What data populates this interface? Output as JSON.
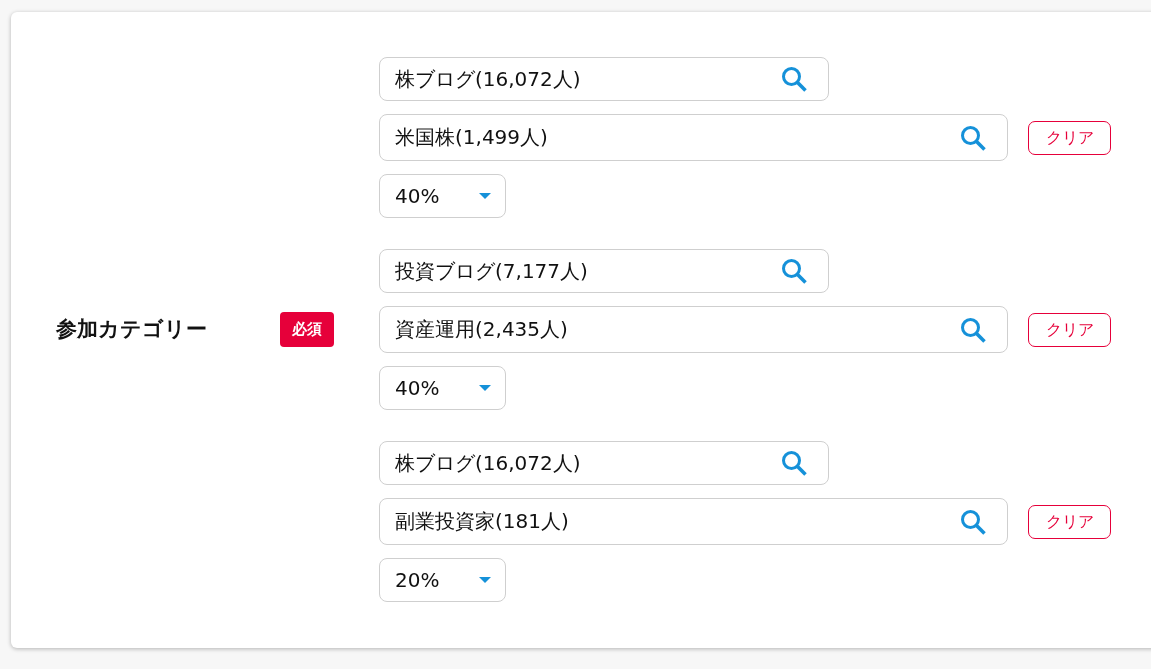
{
  "form": {
    "label": "参加カテゴリー",
    "required_badge": "必須",
    "categories": [
      {
        "parent": {
          "value": "株ブログ(16,072人)"
        },
        "child": {
          "value": "米国株(1,499人)"
        },
        "clear_button": "クリア",
        "ratio": "40%"
      },
      {
        "parent": {
          "value": "投資ブログ(7,177人)"
        },
        "child": {
          "value": "資産運用(2,435人)"
        },
        "clear_button": "クリア",
        "ratio": "40%"
      },
      {
        "parent": {
          "value": "株ブログ(16,072人)"
        },
        "child": {
          "value": "副業投資家(181人)"
        },
        "clear_button": "クリア",
        "ratio": "20%"
      }
    ]
  }
}
